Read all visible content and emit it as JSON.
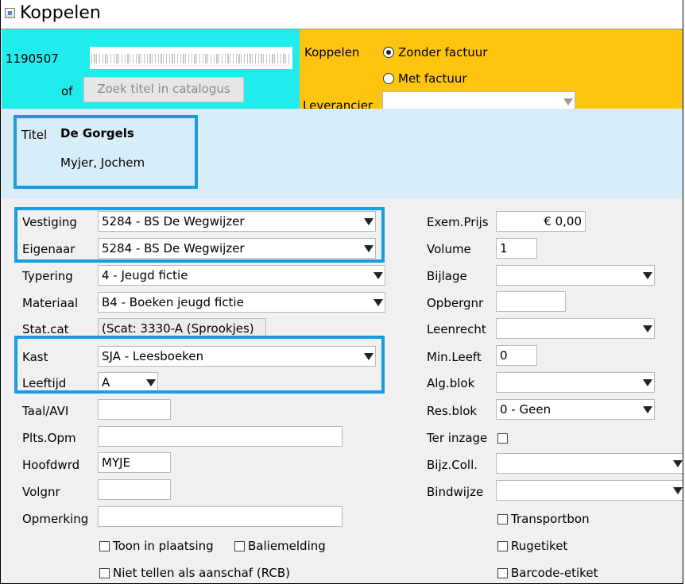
{
  "window": {
    "title": "Koppelen",
    "icon": "java-app-icon"
  },
  "header": {
    "barcode_prefix": "1190507",
    "of_label": "of",
    "search_catalog_button": "Zoek titel in catalogus",
    "koppelen_label": "Koppelen",
    "radio_without_invoice": "Zonder factuur",
    "radio_with_invoice": "Met factuur",
    "selected_radio": "Zonder factuur",
    "leverancier_label": "Leverancier",
    "leverancier_value": ""
  },
  "title_block": {
    "titel_label": "Titel",
    "title": "De Gorgels",
    "author": "Myjer, Jochem"
  },
  "left_form": {
    "vestiging": {
      "label": "Vestiging",
      "value": "5284 - BS De Wegwijzer"
    },
    "eigenaar": {
      "label": "Eigenaar",
      "value": "5284 - BS De Wegwijzer"
    },
    "typering": {
      "label": "Typering",
      "value": "4 - Jeugd fictie"
    },
    "materiaal": {
      "label": "Materiaal",
      "value": "B4 - Boeken jeugd fictie"
    },
    "statcat": {
      "label": "Stat.cat",
      "value": "(Scat: 3330-A (Sprookjes)"
    },
    "kast": {
      "label": "Kast",
      "value": "SJA - Leesboeken"
    },
    "leeftijd": {
      "label": "Leeftijd",
      "value": "A"
    },
    "taalavi": {
      "label": "Taal/AVI",
      "value": ""
    },
    "pltsopm": {
      "label": "Plts.Opm",
      "value": ""
    },
    "hoofdwrd": {
      "label": "Hoofdwrd",
      "value": "MYJE"
    },
    "volgnr": {
      "label": "Volgnr",
      "value": ""
    },
    "opmerking": {
      "label": "Opmerking",
      "value": ""
    }
  },
  "right_form": {
    "exemprijs": {
      "label": "Exem.Prijs",
      "value": "€ 0,00"
    },
    "volume": {
      "label": "Volume",
      "value": "1"
    },
    "bijlage": {
      "label": "Bijlage",
      "value": ""
    },
    "opbergnr": {
      "label": "Opbergnr",
      "value": ""
    },
    "leenrecht": {
      "label": "Leenrecht",
      "value": ""
    },
    "minleeft": {
      "label": "Min.Leeft",
      "value": "0"
    },
    "algblok": {
      "label": "Alg.blok",
      "value": ""
    },
    "resblok": {
      "label": "Res.blok",
      "value": "0 - Geen"
    },
    "terinzage": {
      "label": "Ter inzage"
    },
    "bijzcoll": {
      "label": "Bijz.Coll.",
      "value": ""
    },
    "bindwijze": {
      "label": "Bindwijze",
      "value": ""
    }
  },
  "checkboxes": {
    "toon_in_plaatsing": "Toon in plaatsing",
    "baliemelding": "Baliemelding",
    "niet_tellen": "Niet tellen als aanschaf (RCB)",
    "transportbon": "Transportbon",
    "rugetiket": "Rugetiket",
    "barcode_etiket": "Barcode-etiket"
  },
  "colors": {
    "cyan_panel": "#20ecee",
    "orange_panel": "#fdc50f",
    "info_panel": "#d7edf7",
    "highlight": "#1b9ce0"
  }
}
